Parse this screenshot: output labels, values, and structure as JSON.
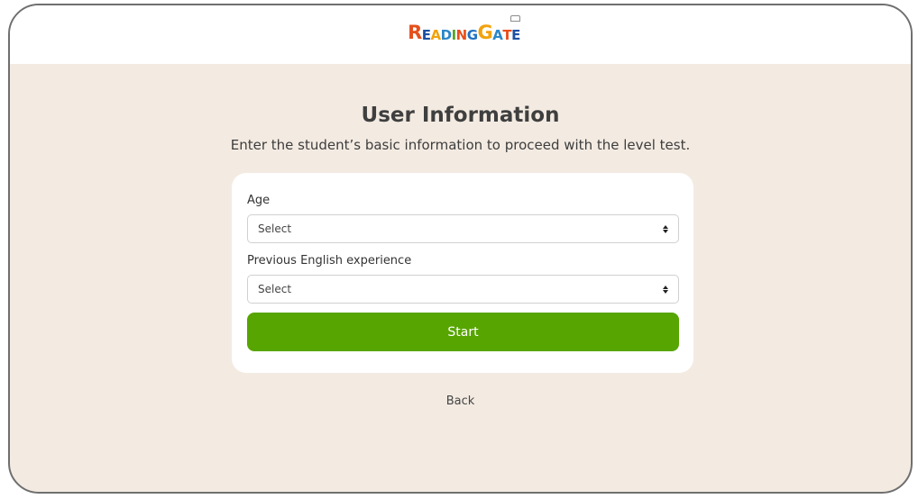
{
  "header": {
    "logo_parts": [
      "R",
      "EADING",
      "G",
      "ATE"
    ],
    "logo_colors": [
      "#e8511e",
      "#1d4fa3",
      "#f2a20c",
      "#2b86c8",
      "#5aa52a",
      "#e94e1b",
      "#1f72c2",
      "#f2a20c",
      "#2b86c8",
      "#e94e1b",
      "#1d4fa3"
    ]
  },
  "main": {
    "title": "User Information",
    "subtitle": "Enter the student’s basic information to proceed with the level test."
  },
  "form": {
    "age": {
      "label": "Age",
      "value": "Select"
    },
    "experience": {
      "label": "Previous English experience",
      "value": "Select"
    },
    "start_label": "Start"
  },
  "footer": {
    "back_label": "Back"
  },
  "colors": {
    "accent": "#57a500",
    "background": "#f3ebe2"
  },
  "icons": {
    "select_arrow": "sort-arrows-icon"
  }
}
